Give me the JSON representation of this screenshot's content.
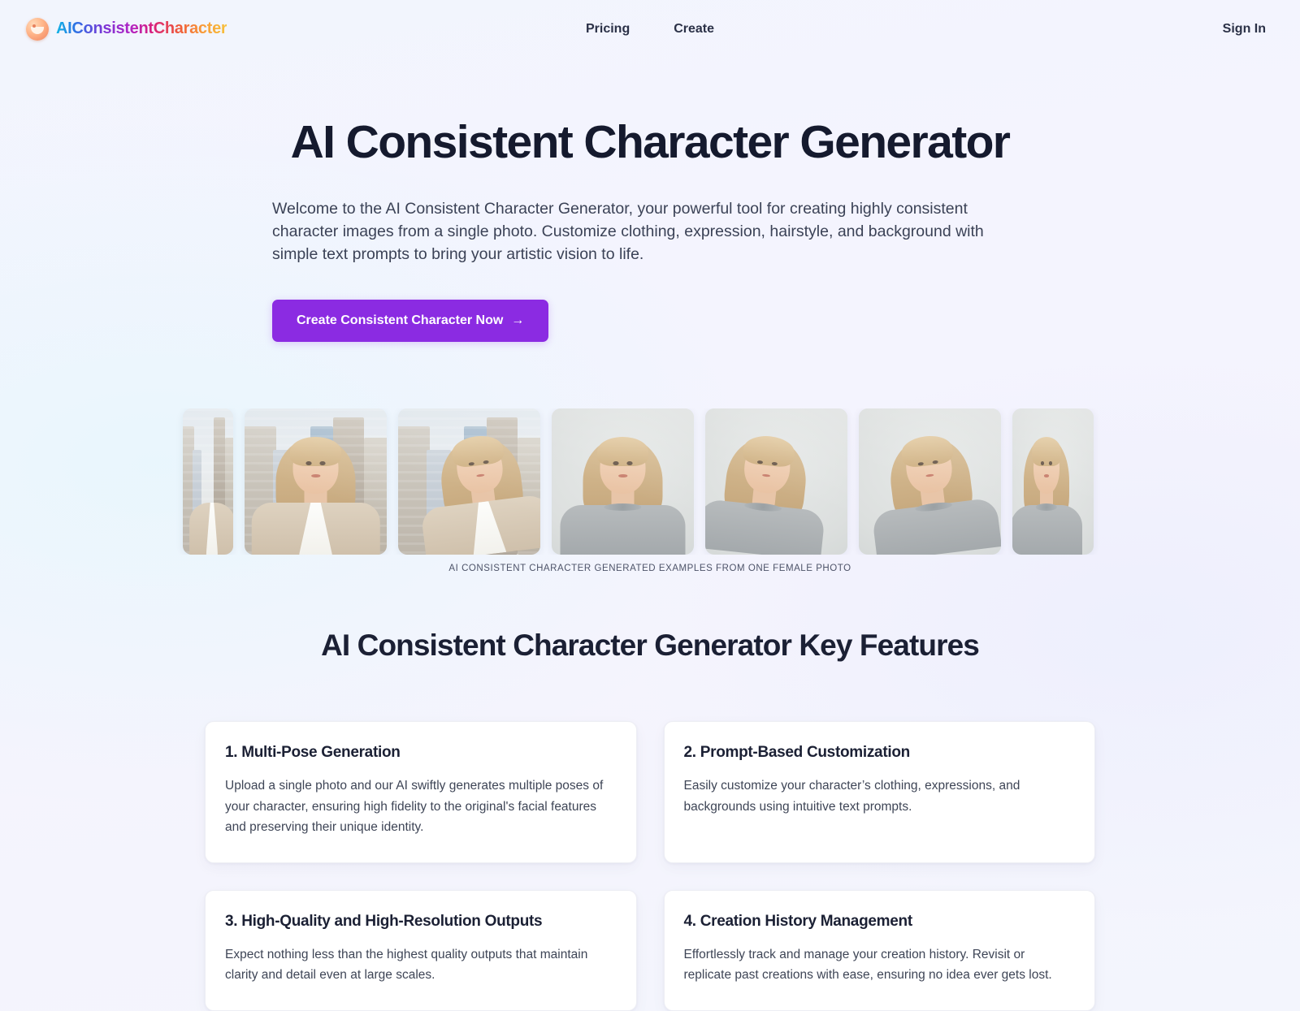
{
  "header": {
    "brand": {
      "name": "AIConsistentCharacter",
      "icon": "face-circle-icon"
    },
    "nav": [
      {
        "label": "Pricing",
        "name": "nav-link-pricing"
      },
      {
        "label": "Create",
        "name": "nav-link-create"
      }
    ],
    "signin_label": "Sign In"
  },
  "hero": {
    "title": "AI Consistent Character Generator",
    "subtitle": "Welcome to the AI Consistent Character Generator, your powerful tool for creating highly consistent character images from a single photo. Customize clothing, expression, hairstyle, and background with simple text prompts to bring your artistic vision to life.",
    "cta_label": "Create Consistent Character Now",
    "cta_arrow": "→",
    "cta_color": "#8b2be2"
  },
  "gallery": {
    "caption": "AI CONSISTENT CHARACTER GENERATED EXAMPLES FROM ONE FEMALE PHOTO",
    "items": [
      {
        "alt": "Blonde woman in beige blazer on city street, cropped left",
        "scene": "city"
      },
      {
        "alt": "Blonde woman in beige blazer smiling on city street",
        "scene": "city"
      },
      {
        "alt": "Blonde woman in beige blazer, head tilted, city street",
        "scene": "city"
      },
      {
        "alt": "Blonde woman in grey sweater, studio grey background",
        "scene": "studio"
      },
      {
        "alt": "Blonde woman in grey sweater looking up, studio grey background",
        "scene": "studio"
      },
      {
        "alt": "Blonde woman in grey sweater, head tilted down, studio grey background",
        "scene": "studio"
      },
      {
        "alt": "Blonde woman in grey sweater, cropped right",
        "scene": "studio"
      }
    ]
  },
  "features": {
    "title": "AI Consistent Character Generator Key Features",
    "cards": [
      {
        "title": "1. Multi-Pose Generation",
        "body": "Upload a single photo and our AI swiftly generates multiple poses of your character, ensuring high fidelity to the original's facial features and preserving their unique identity."
      },
      {
        "title": "2. Prompt-Based Customization",
        "body": "Easily customize your character’s clothing, expressions, and backgrounds using intuitive text prompts."
      },
      {
        "title": "3. High-Quality and High-Resolution Outputs",
        "body": "Expect nothing less than the highest quality outputs that maintain clarity and detail even at large scales."
      },
      {
        "title": "4. Creation History Management",
        "body": "Effortlessly track and manage your creation history. Revisit or replicate past creations with ease, ensuring no idea ever gets lost."
      }
    ]
  }
}
